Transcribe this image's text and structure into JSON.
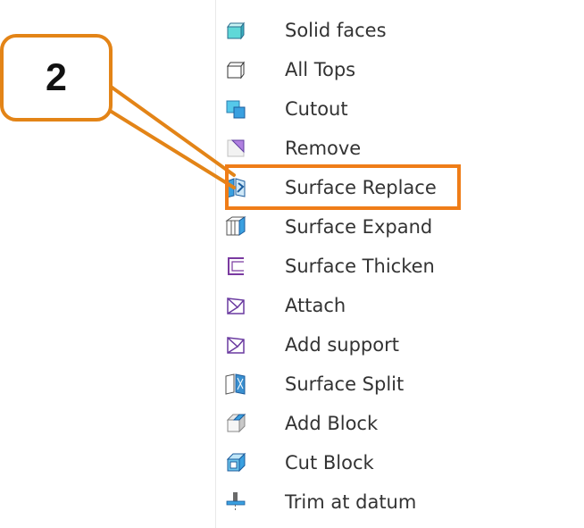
{
  "callout": {
    "number": "2"
  },
  "accent_color": "#ef7d18",
  "menu": {
    "items": [
      {
        "label": "Solid faces",
        "icon": "solid-faces-icon"
      },
      {
        "label": "All Tops",
        "icon": "all-tops-icon"
      },
      {
        "label": "Cutout",
        "icon": "cutout-icon"
      },
      {
        "label": "Remove",
        "icon": "remove-icon"
      },
      {
        "label": "Surface Replace",
        "icon": "surface-replace-icon",
        "highlighted": true
      },
      {
        "label": "Surface Expand",
        "icon": "surface-expand-icon"
      },
      {
        "label": "Surface Thicken",
        "icon": "surface-thicken-icon"
      },
      {
        "label": "Attach",
        "icon": "attach-icon"
      },
      {
        "label": "Add support",
        "icon": "add-support-icon"
      },
      {
        "label": "Surface Split",
        "icon": "surface-split-icon"
      },
      {
        "label": "Add Block",
        "icon": "add-block-icon"
      },
      {
        "label": "Cut Block",
        "icon": "cut-block-icon"
      },
      {
        "label": "Trim at datum",
        "icon": "trim-at-datum-icon"
      }
    ]
  }
}
